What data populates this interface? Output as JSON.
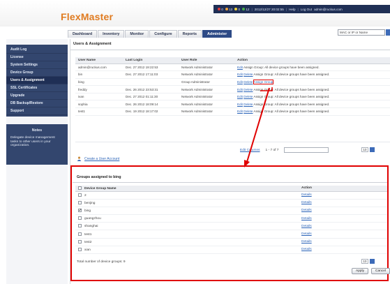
{
  "app": {
    "logo": "FlexMaster"
  },
  "status_bar": {
    "alarms": [
      {
        "count": "0",
        "color": "#e23b3b"
      },
      {
        "count": "13",
        "color": "#f0a23a"
      },
      {
        "count": "0",
        "color": "#f2d43b"
      },
      {
        "count": "12",
        "color": "#46b04a"
      }
    ],
    "timestamp": "2012/12/27 20:02:55",
    "help": "Help",
    "logout": "Log Out",
    "user": "admin@ruckus.com"
  },
  "tabs": [
    "Dashboard",
    "Inventory",
    "Monitor",
    "Configure",
    "Reports",
    "Administer"
  ],
  "active_tab": "Administer",
  "search": {
    "placeholder": "MAC or IP or Name"
  },
  "sidebar": {
    "items": [
      {
        "label": "Audit Log"
      },
      {
        "label": "License"
      },
      {
        "label": "System Settings"
      },
      {
        "label": "Device Group"
      },
      {
        "label": "Users & Assignment"
      },
      {
        "label": "SSL Certificates"
      },
      {
        "label": "Upgrade"
      },
      {
        "label": "DB Backup/Restore"
      },
      {
        "label": "Support"
      }
    ],
    "notes_title": "Notes",
    "notes_text": "Delegate device management tasks to other users in your organization."
  },
  "users_section": {
    "title": "Users & Assignment",
    "columns": [
      "User Name",
      "Last Login",
      "User Role",
      "Action"
    ],
    "rows": [
      {
        "name": "admin@ruckus.com",
        "last_login": "Dec. 27 2012 19:22:53",
        "role": "Network Administrator",
        "edit": "Edit",
        "delete": "",
        "assign": "Assign Group: All device groups have been assigned."
      },
      {
        "name": "bin",
        "last_login": "Dec. 27 2012 17:11:03",
        "role": "Network Administrator",
        "edit": "Edit",
        "delete": "Delete",
        "assign": "Assign Group: All device groups have been assigned."
      },
      {
        "name": "bing",
        "last_login": "",
        "role": "Group Administrator",
        "edit": "Edit",
        "delete": "Delete",
        "assign": "Assign Group"
      },
      {
        "name": "freddy",
        "last_login": "Dec. 26 2012 23:53:31",
        "role": "Network Administrator",
        "edit": "Edit",
        "delete": "Delete",
        "assign": "Assign Group: All device groups have been assigned."
      },
      {
        "name": "ivan",
        "last_login": "Dec. 27 2012 01:11:30",
        "role": "Network Administrator",
        "edit": "Edit",
        "delete": "Delete",
        "assign": "Assign Group: All device groups have been assigned."
      },
      {
        "name": "sophia",
        "last_login": "Dec. 26 2012 18:09:14",
        "role": "Network Administrator",
        "edit": "Edit",
        "delete": "Delete",
        "assign": "Assign Group: All device groups have been assigned."
      },
      {
        "name": "test1",
        "last_login": "Dec. 19 2012 18:17:02",
        "role": "Network Administrator",
        "edit": "Edit",
        "delete": "Delete",
        "assign": "Assign Group: All device groups have been assigned."
      }
    ],
    "edit_columns": "Edit Columns",
    "pagination": "1 - 7 of 7",
    "page_size": "10",
    "create_user": "Create a User Account"
  },
  "groups_section": {
    "title": "Groups assigned to bing",
    "columns": [
      "Device Group Name",
      "Action"
    ],
    "rows": [
      {
        "name": "2",
        "checked": false,
        "action": "Details"
      },
      {
        "name": "benjing",
        "checked": false,
        "action": "Details"
      },
      {
        "name": "bing",
        "checked": true,
        "action": "Details"
      },
      {
        "name": "guangzhou",
        "checked": false,
        "action": "Details"
      },
      {
        "name": "shanghai",
        "checked": false,
        "action": "Details"
      },
      {
        "name": "test1",
        "checked": false,
        "action": "Details"
      },
      {
        "name": "test2",
        "checked": false,
        "action": "Details"
      },
      {
        "name": "xian",
        "checked": false,
        "action": "Details"
      }
    ],
    "total": "Total number of device groups: 9",
    "page_size": "10",
    "apply": "Apply",
    "cancel": "Cancel"
  },
  "colors": {
    "accent": "#e07b20",
    "nav_bg": "#33466e",
    "highlight": "#e00000",
    "link": "#2a63b8"
  }
}
